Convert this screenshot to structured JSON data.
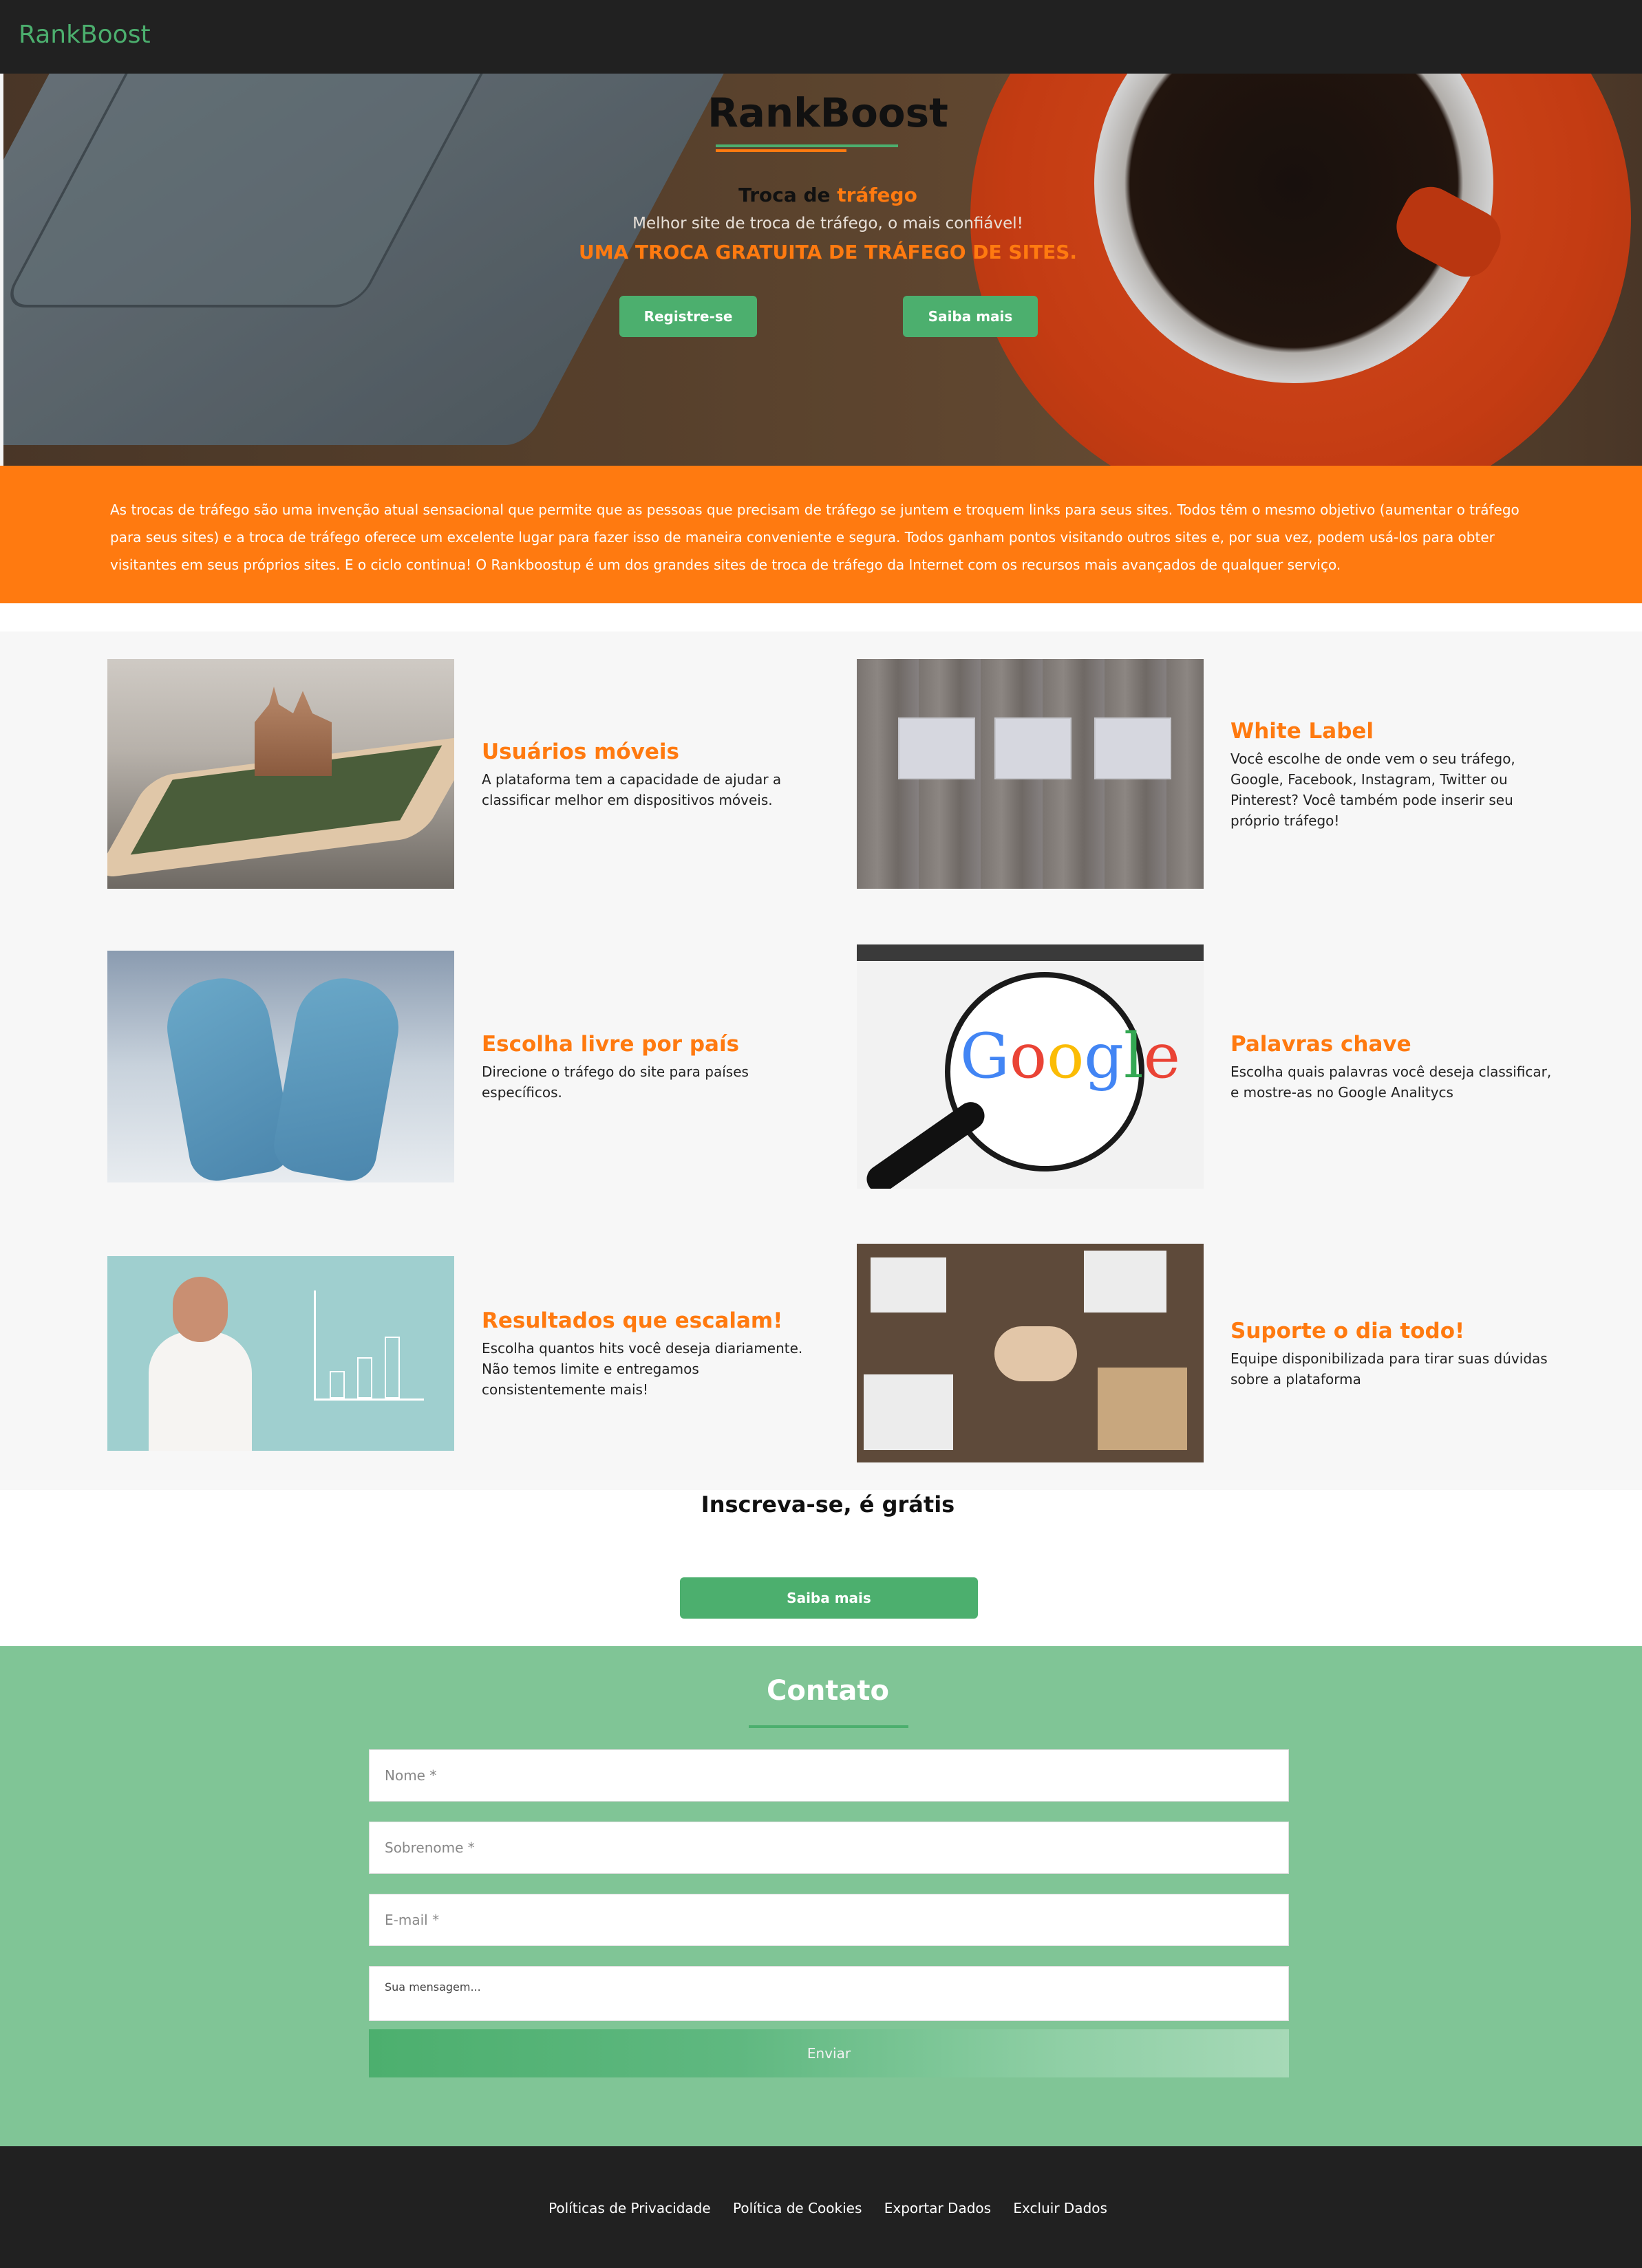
{
  "nav": {
    "brand": "RankBoost"
  },
  "hero": {
    "title": "RankBoost",
    "subtitle_prefix": "Troca de",
    "subtitle_highlight": "tráfego",
    "tagline": "Melhor site de troca de tráfego, o mais confiável!",
    "caps": "UMA TROCA GRATUITA DE TRÁFEGO DE SITES.",
    "register_label": "Registre-se",
    "learn_more_label": "Saiba mais"
  },
  "intro": {
    "text": "As trocas de tráfego são uma invenção atual sensacional que permite que as pessoas que precisam de tráfego se juntem e troquem links para seus sites. Todos têm o mesmo objetivo (aumentar o tráfego para seus sites) e a troca de tráfego oferece um excelente lugar para fazer isso de maneira conveniente e segura. Todos ganham pontos visitando outros sites e, por sua vez, podem usá-los para obter visitantes em seus próprios sites. E o ciclo continua! O Rankboostup é um dos grandes sites de troca de tráfego da Internet com os recursos mais avançados de qualquer serviço."
  },
  "features": [
    {
      "title": "Usuários móveis",
      "text": "A plataforma tem a capacidade de ajudar a classificar melhor em dispositivos móveis."
    },
    {
      "title": "White Label",
      "text": "Você escolhe de onde vem o seu tráfego, Google, Facebook, Instagram, Twitter ou Pinterest? Você também pode inserir seu próprio tráfego!"
    },
    {
      "title": "Escolha livre por país",
      "text": "Direcione o tráfego do site para países específicos."
    },
    {
      "title": "Palavras chave",
      "text": "Escolha quais palavras você deseja classificar, e mostre-as no Google Analitycs"
    },
    {
      "title": "Resultados que escalam!",
      "text": "Escolha quantos hits você deseja diariamente. Não temos limite e entregamos consistentemente mais!"
    },
    {
      "title": "Suporte o dia todo!",
      "text": "Equipe disponibilizada para tirar suas dúvidas sobre a plataforma"
    }
  ],
  "cta": {
    "title": "Inscreva-se, é grátis",
    "button_label": "Saiba mais"
  },
  "contact": {
    "title": "Contato",
    "name_placeholder": "Nome *",
    "surname_placeholder": "Sobrenome *",
    "email_placeholder": "E-mail *",
    "message_placeholder": "Sua mensagem...",
    "send_label": "Enviar"
  },
  "footer": {
    "links": [
      "Políticas de Privacidade",
      "Política de Cookies",
      "Exportar Dados",
      "Excluir Dados"
    ]
  },
  "colors": {
    "accent_green": "#4caf6e",
    "accent_orange": "#ff7a10",
    "contact_bg": "#80c596",
    "dark": "#212121"
  }
}
